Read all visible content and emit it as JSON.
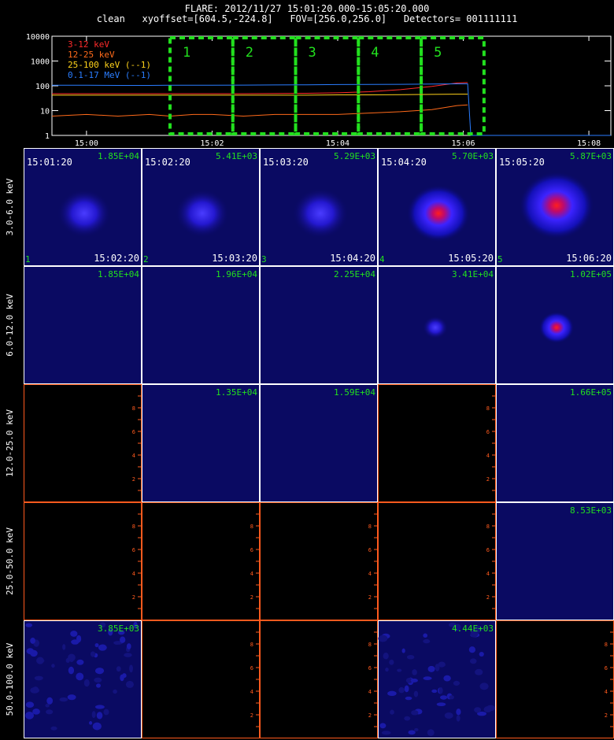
{
  "header": {
    "line1": "FLARE: 2012/11/27 15:01:20.000-15:05:20.000",
    "line2": "clean   xyoffset=[604.5,-224.8]   FOV=[256.0,256.0]   Detectors= 001111111"
  },
  "chart_data": [
    {
      "type": "line",
      "yscale": "log",
      "ylim": [
        1,
        10000
      ],
      "y_ticks": [
        "1",
        "10",
        "100",
        "1000",
        "10000"
      ],
      "x_ticks": [
        "15:00",
        "15:02",
        "15:04",
        "15:06",
        "15:08"
      ],
      "x_tick_minutes": [
        0,
        2,
        4,
        6,
        8
      ],
      "xlim_minutes": [
        -0.55,
        8.35
      ],
      "x_minutes": [
        -0.55,
        0,
        0.5,
        1,
        1.33,
        1.7,
        2,
        2.5,
        3,
        3.5,
        4,
        4.5,
        5,
        5.5,
        5.9,
        6.07,
        6.12,
        6.5,
        7,
        7.5,
        8,
        8.35
      ],
      "series": [
        {
          "name": "3-12 keV",
          "color": "#ff2a2a",
          "values": [
            48,
            48,
            48,
            48,
            48,
            48,
            48,
            48,
            49,
            50,
            52,
            58,
            70,
            95,
            130,
            135,
            null,
            null,
            null,
            null,
            null,
            null
          ]
        },
        {
          "name": "12-25 keV",
          "color": "#ff6a1a",
          "values": [
            6,
            7,
            6,
            7,
            6,
            7,
            7,
            6,
            7,
            7,
            7,
            8,
            9,
            11,
            16,
            17,
            null,
            null,
            null,
            null,
            null,
            null
          ]
        },
        {
          "name": "25-100 keV (--1)",
          "color": "#ffd21a",
          "values": [
            42,
            42,
            42,
            42,
            42,
            42,
            42,
            42,
            42,
            42,
            43,
            43,
            44,
            45,
            46,
            46,
            null,
            null,
            null,
            null,
            null,
            null
          ]
        },
        {
          "name": "0.1-17 MeV (--1)",
          "color": "#2a7dff",
          "values": [
            105,
            105,
            104,
            104,
            105,
            106,
            106,
            107,
            108,
            110,
            112,
            113,
            115,
            118,
            120,
            120,
            1,
            1,
            1,
            1,
            1,
            1
          ]
        }
      ],
      "annotations": [
        {
          "label": "1",
          "x_start": 1.33,
          "x_end": 2.33
        },
        {
          "label": "2",
          "x_start": 2.33,
          "x_end": 3.33
        },
        {
          "label": "3",
          "x_start": 3.33,
          "x_end": 4.33
        },
        {
          "label": "4",
          "x_start": 4.33,
          "x_end": 5.33
        },
        {
          "label": "5",
          "x_start": 5.33,
          "x_end": 6.33
        }
      ]
    },
    {
      "type": "heatmap",
      "row_labels": [
        "3.0-6.0 keV",
        "6.0-12.0 keV",
        "12.0-25.0 keV",
        "25.0-50.0 keV",
        "50.0-100.0 keV"
      ],
      "time_start": [
        "15:01:20",
        "15:02:20",
        "15:03:20",
        "15:04:20",
        "15:05:20"
      ],
      "time_end": [
        "15:02:20",
        "15:03:20",
        "15:04:20",
        "15:05:20",
        "15:06:20"
      ],
      "interval_numbers": [
        "1",
        "2",
        "3",
        "4",
        "5"
      ],
      "axis_ticks": [
        "2",
        "4",
        "6",
        "8"
      ],
      "values": [
        [
          "1.85E+04",
          "5.41E+03",
          "5.29E+03",
          "5.70E+03",
          "5.87E+03"
        ],
        [
          "1.85E+04",
          "1.96E+04",
          "2.25E+04",
          "3.41E+04",
          "1.02E+05"
        ],
        [
          "",
          "1.35E+04",
          "1.59E+04",
          "",
          "1.66E+05"
        ],
        [
          "",
          "",
          "",
          "",
          "8.53E+03"
        ],
        [
          "3.85E+03",
          "",
          "",
          "4.44E+03",
          ""
        ]
      ],
      "image_present": [
        [
          true,
          true,
          true,
          true,
          true
        ],
        [
          true,
          true,
          true,
          true,
          true
        ],
        [
          false,
          true,
          true,
          false,
          true
        ],
        [
          false,
          false,
          false,
          false,
          true
        ],
        [
          true,
          false,
          false,
          true,
          false
        ]
      ],
      "source_strength": [
        [
          0.55,
          0.55,
          0.6,
          0.75,
          1.0
        ],
        [
          0,
          0,
          0,
          0.3,
          0.75
        ],
        [
          0,
          0,
          0,
          0,
          0
        ],
        [
          0,
          0,
          0,
          0,
          0
        ],
        [
          0,
          0,
          0,
          0,
          0
        ]
      ]
    }
  ]
}
